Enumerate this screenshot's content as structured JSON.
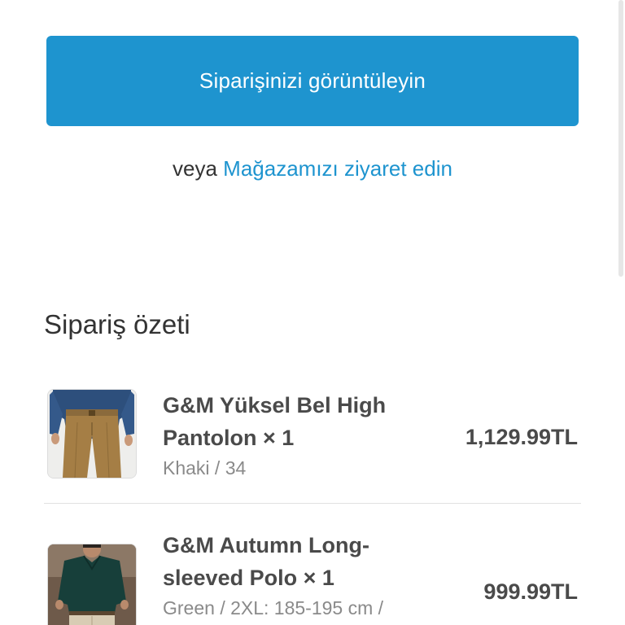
{
  "actions": {
    "view_order_label": "Siparişinizi görüntüleyin",
    "or_label": "veya",
    "visit_store_label": "Mağazamızı ziyaret edin"
  },
  "summary": {
    "title": "Sipariş özeti",
    "items": [
      {
        "name": "G&M Yüksel Bel High Pantolon × 1",
        "variant": "Khaki / 34",
        "price": "1,129.99TL",
        "image": "khaki-trousers-thumbnail"
      },
      {
        "name": "G&M Autumn Long-sleeved Polo × 1",
        "variant": "Green / 2XL: 185-195 cm /",
        "price": "999.99TL",
        "image": "green-polo-thumbnail"
      }
    ]
  },
  "colors": {
    "accent": "#1e94cf",
    "text": "#333333",
    "muted": "#8a8a8a"
  }
}
